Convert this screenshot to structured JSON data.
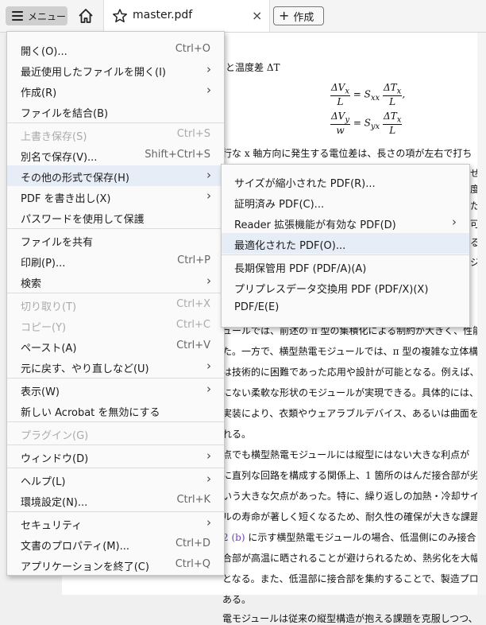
{
  "toolbar": {
    "menu_label": "メニュー",
    "tab_title": "master.pdf",
    "close_glyph": "×",
    "create_label": "作成",
    "plus_glyph": "+",
    "icons": [
      "hamburger-icon",
      "home-icon",
      "star-icon",
      "close-icon",
      "plus-icon"
    ]
  },
  "document": {
    "lines": [
      "と温度差 ΔT",
      "行な x 軸方向に発生する電位差は、長さの項が左右で打ち",
      "ュールでは、前述の π 型の集積化による制約が大きく、性能",
      "た。一方で、横型熱電モジュールでは、π 型の複雑な立体構",
      "は技術的に困難であった応用や設計が可能となる。例えば、",
      "にない柔軟な形状のモジュールが実現できる。具体的には、",
      "実装により、衣類やウェアラブルデバイス、あるいは曲面を",
      "れる。",
      "点でも横型熱電モジュールには縦型にはない大きな利点が",
      "に直列な回路を構成する関係上、1 箇所のはんだ接合部が劣",
      "いう大きな欠点があった。特に、繰り返しの加熱・冷却サイ",
      "ルの寿命が著しく短くなるため、耐久性の確保が大きな課題",
      "に示す横型熱電モジュールの場合、低温側にのみ接合",
      "合部が高温に晒されることが避けられるため、熱劣化を大幅",
      "となる。また、低温部に接合部を集約することで、製造プロ",
      "ある。",
      "電モジュールは従来の縦型構造が抱える課題を克服しつつ、"
    ],
    "ref": "2 (b)",
    "right_fragments": [
      "せて",
      "度差",
      "ため",
      "可能",
      "る実",
      "ジュ"
    ]
  },
  "main_menu": {
    "items": [
      {
        "label": "開く(O)...",
        "shortcut": "Ctrl+O"
      },
      {
        "label": "最近使用したファイルを開く(I)",
        "arrow": "›"
      },
      {
        "label": "作成(R)",
        "arrow": "›"
      },
      {
        "label": "ファイルを結合(B)"
      },
      {
        "label": "上書き保存(S)",
        "shortcut": "Ctrl+S"
      },
      {
        "label": "別名で保存(V)...",
        "shortcut": "Shift+Ctrl+S"
      },
      {
        "label": "その他の形式で保存(H)",
        "arrow": "›"
      },
      {
        "label": "PDF を書き出し(X)",
        "arrow": "›"
      },
      {
        "label": "パスワードを使用して保護"
      },
      {
        "label": "ファイルを共有"
      },
      {
        "label": "印刷(P)...",
        "shortcut": "Ctrl+P"
      },
      {
        "label": "検索",
        "arrow": "›"
      },
      {
        "label": "切り取り(T)",
        "shortcut": "Ctrl+X"
      },
      {
        "label": "コピー(Y)",
        "shortcut": "Ctrl+C"
      },
      {
        "label": "ペースト(A)",
        "shortcut": "Ctrl+V"
      },
      {
        "label": "元に戻す、やり直しなど(U)",
        "arrow": "›"
      },
      {
        "label": "表示(W)",
        "arrow": "›"
      },
      {
        "label": "新しい Acrobat を無効にする"
      },
      {
        "label": "プラグイン(G)"
      },
      {
        "label": "ウィンドウ(D)",
        "arrow": "›"
      },
      {
        "label": "ヘルプ(L)",
        "arrow": "›"
      },
      {
        "label": "環境設定(N)...",
        "shortcut": "Ctrl+K"
      },
      {
        "label": "セキュリティ",
        "arrow": "›"
      },
      {
        "label": "文書のプロパティ(M)...",
        "shortcut": "Ctrl+D"
      },
      {
        "label": "アプリケーションを終了(C)",
        "shortcut": "Ctrl+Q"
      }
    ]
  },
  "submenu": {
    "items": [
      {
        "label": "サイズが縮小された PDF(R)..."
      },
      {
        "label": "証明済み PDF(C)..."
      },
      {
        "label": "Reader 拡張機能が有効な PDF(D)",
        "arrow": "›"
      },
      {
        "label": "最適化された PDF(O)..."
      },
      {
        "label": "長期保管用 PDF (PDF/A)(A)"
      },
      {
        "label": "プリプレスデータ交換用 PDF (PDF/X)(X)"
      },
      {
        "label": "PDF/E(E)"
      }
    ]
  }
}
